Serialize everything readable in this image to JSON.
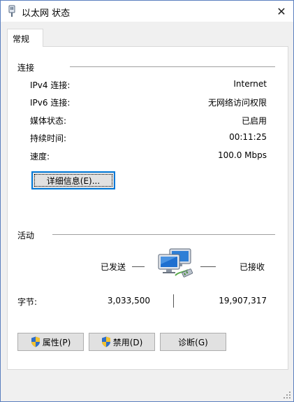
{
  "window": {
    "title": "以太网 状态",
    "close_symbol": "✕"
  },
  "tab": {
    "label": "常规"
  },
  "connection": {
    "title": "连接",
    "rows": [
      {
        "label": "IPv4 连接:",
        "value": "Internet"
      },
      {
        "label": "IPv6 连接:",
        "value": "无网络访问权限"
      },
      {
        "label": "媒体状态:",
        "value": "已启用"
      },
      {
        "label": "持续时间:",
        "value": "00:11:25"
      },
      {
        "label": "速度:",
        "value": "100.0 Mbps"
      }
    ],
    "details_button": "详细信息(E)..."
  },
  "activity": {
    "title": "活动",
    "sent_label": "已发送",
    "received_label": "已接收",
    "bytes_label": "字节:",
    "bytes_sent": "3,033,500",
    "bytes_received": "19,907,317"
  },
  "buttons": {
    "properties": "属性(P)",
    "disable": "禁用(D)",
    "diagnose": "诊断(G)"
  },
  "icons": {
    "title": "network-adapter-icon",
    "activity": "network-computers-icon",
    "shield": "uac-shield-icon"
  },
  "colors": {
    "window_border": "#5b7fbf",
    "focus": "#0078d7"
  }
}
